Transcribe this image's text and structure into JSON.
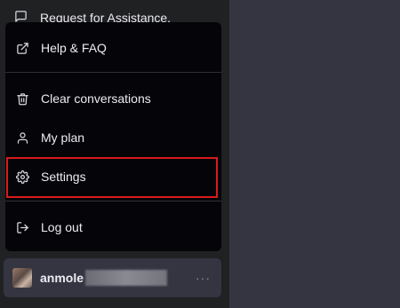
{
  "colors": {
    "sidebar_bg": "#202123",
    "main_bg": "#343541",
    "menu_bg": "#050509",
    "highlight_border": "#d81b1b",
    "text": "#ececf1"
  },
  "top_row": {
    "icon": "message-icon",
    "label": "Request for Assistance."
  },
  "menu": {
    "items": [
      {
        "icon": "external-link-icon",
        "label": "Help & FAQ"
      },
      {
        "icon": "trash-icon",
        "label": "Clear conversations"
      },
      {
        "icon": "user-icon",
        "label": "My plan"
      },
      {
        "icon": "gear-icon",
        "label": "Settings"
      },
      {
        "icon": "logout-icon",
        "label": "Log out"
      }
    ]
  },
  "user": {
    "name": "anmole",
    "menu_icon": "more-icon",
    "menu_glyph": "···"
  }
}
